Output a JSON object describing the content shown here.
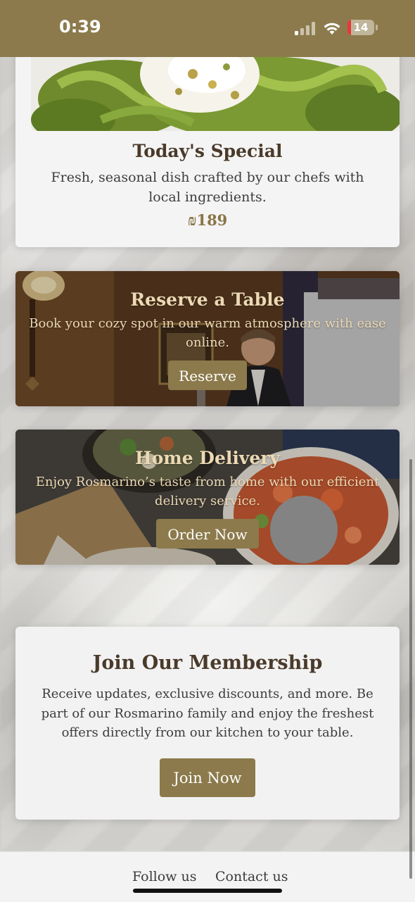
{
  "status_bar": {
    "time": "0:39",
    "battery_level": "14",
    "battery_fraction": 0.14,
    "background": "#8c7a4c"
  },
  "special": {
    "title": "Today's Special",
    "description": "Fresh, seasonal dish crafted by our chefs with local ingredients.",
    "price": "₪189"
  },
  "reserve": {
    "title": "Reserve a Table",
    "description": "Book your cozy spot in our warm atmosphere with ease online.",
    "button_label": "Reserve"
  },
  "delivery": {
    "title": "Home Delivery",
    "description": "Enjoy Rosmarino’s taste from home with our efficient delivery service.",
    "button_label": "Order Now"
  },
  "membership": {
    "title": "Join Our Membership",
    "description": "Receive updates, exclusive discounts, and more. Be part of our Rosmarino family and enjoy the freshest offers directly from our kitchen to your table.",
    "button_label": "Join Now"
  },
  "footer": {
    "follow_label": "Follow us",
    "contact_label": "Contact us"
  },
  "icons": {
    "signal": "cellular-signal-icon",
    "wifi": "wifi-icon",
    "battery": "battery-icon"
  },
  "colors": {
    "accent": "#8c7a4c",
    "heading": "#4a3a2a",
    "photo_text": "#ecd9b4"
  }
}
